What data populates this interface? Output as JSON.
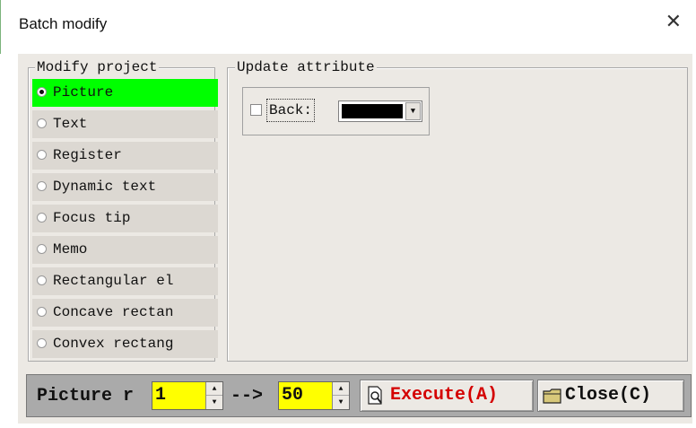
{
  "window": {
    "title": "Batch modify",
    "close_glyph": "✕"
  },
  "modify_project": {
    "legend": "Modify project",
    "items": [
      {
        "label": "Picture",
        "selected": true
      },
      {
        "label": "Text",
        "selected": false
      },
      {
        "label": "Register",
        "selected": false
      },
      {
        "label": "Dynamic text",
        "selected": false
      },
      {
        "label": "Focus tip",
        "selected": false
      },
      {
        "label": "Memo",
        "selected": false
      },
      {
        "label": "Rectangular el",
        "selected": false
      },
      {
        "label": "Concave rectan",
        "selected": false
      },
      {
        "label": "Convex rectang",
        "selected": false
      }
    ],
    "selected_color": "#00ff00"
  },
  "update_attribute": {
    "legend": "Update attribute",
    "back_label": "Back:",
    "back_checked": false,
    "back_color": "#000000"
  },
  "range": {
    "label": "Picture r",
    "from_value": "1",
    "arrow": "-->",
    "to_value": "50",
    "field_color": "#ffff00"
  },
  "buttons": {
    "execute_label": "Execute(A)",
    "close_label": "Close(C)"
  },
  "icons": {
    "execute": "magnifier-page-icon",
    "close": "folder-icon"
  }
}
